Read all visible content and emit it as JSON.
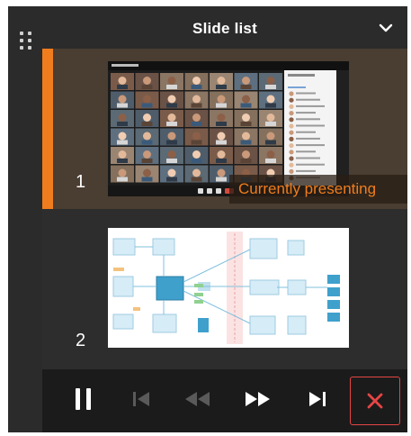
{
  "header": {
    "title": "Slide list"
  },
  "slides": [
    {
      "number": "1",
      "status": "Currently presenting",
      "active": true,
      "thumbnail": "video-call-grid"
    },
    {
      "number": "2",
      "status": "",
      "active": false,
      "thumbnail": "network-diagram"
    }
  ],
  "controls": [
    {
      "icon": "pause-icon",
      "enabled": true
    },
    {
      "icon": "skip-to-start-icon",
      "enabled": false
    },
    {
      "icon": "rewind-icon",
      "enabled": false
    },
    {
      "icon": "fast-forward-icon",
      "enabled": true
    },
    {
      "icon": "skip-to-end-icon",
      "enabled": true
    },
    {
      "icon": "close-icon",
      "enabled": true
    }
  ],
  "colors": {
    "accent": "#f07d1d",
    "panel_bg": "#2b2b2b",
    "controls_bg": "#1b1b1b",
    "stop": "#e64545"
  }
}
